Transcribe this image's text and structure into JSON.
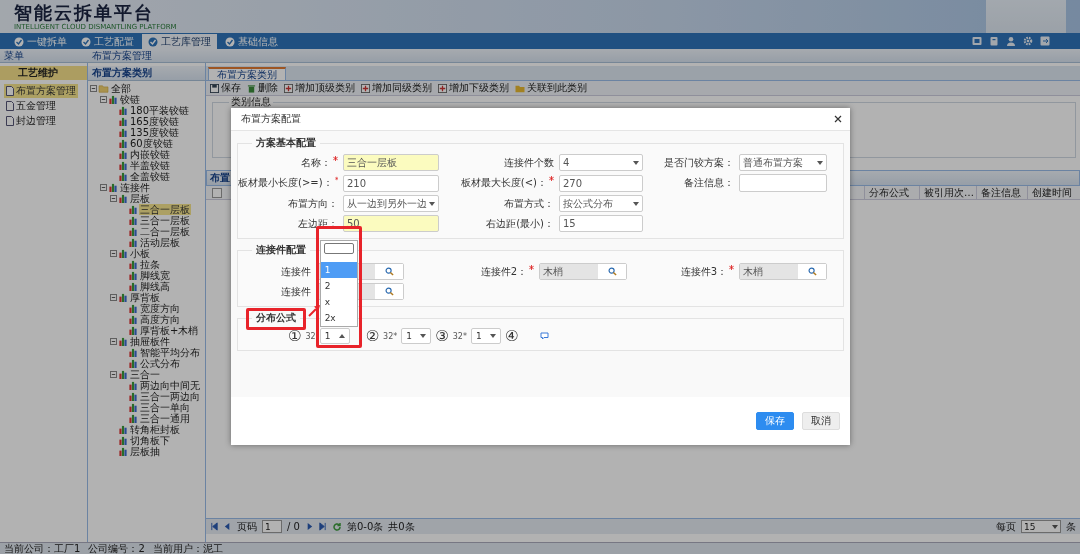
{
  "header": {
    "title": "智能云拆单平台",
    "subtitle": "INTELLIGENT CLOUD DISMANTLING PLATFORM"
  },
  "nav_tabs": [
    {
      "label": "一键拆单",
      "selected": false
    },
    {
      "label": "工艺配置",
      "selected": false
    },
    {
      "label": "工艺库管理",
      "selected": true
    },
    {
      "label": "基础信息",
      "selected": false
    }
  ],
  "menu_panel": {
    "title": "菜单",
    "section": "工艺维护",
    "items": [
      {
        "label": "布置方案管理",
        "selected": true
      },
      {
        "label": "五金管理",
        "selected": false
      },
      {
        "label": "封边管理",
        "selected": false
      }
    ]
  },
  "breadcrumb": "布置方案管理",
  "category_panel": {
    "title": "布置方案类别",
    "tree": [
      {
        "label": "全部",
        "kind": "folder",
        "expanded": true,
        "selected": false,
        "children": [
          {
            "label": "铰链",
            "kind": "category",
            "expanded": true,
            "selected": false,
            "children": [
              {
                "label": "180平装铰链",
                "kind": "category",
                "selected": false
              },
              {
                "label": "165度铰链",
                "kind": "category",
                "selected": false
              },
              {
                "label": "135度铰链",
                "kind": "category",
                "selected": false
              },
              {
                "label": "60度铰链",
                "kind": "category",
                "selected": false
              },
              {
                "label": "内嵌铰链",
                "kind": "category",
                "selected": false
              },
              {
                "label": "半盖铰链",
                "kind": "category",
                "selected": false
              },
              {
                "label": "全盖铰链",
                "kind": "category",
                "selected": false
              }
            ]
          },
          {
            "label": "连接件",
            "kind": "category",
            "expanded": true,
            "selected": false,
            "children": [
              {
                "label": "层板",
                "kind": "category",
                "expanded": true,
                "selected": false,
                "children": [
                  {
                    "label": "三合一层板",
                    "kind": "category",
                    "selected": true
                  },
                  {
                    "label": "三合一层板",
                    "kind": "category",
                    "selected": false
                  },
                  {
                    "label": "二合一层板",
                    "kind": "category",
                    "selected": false
                  },
                  {
                    "label": "活动层板",
                    "kind": "category",
                    "selected": false
                  }
                ]
              },
              {
                "label": "小板",
                "kind": "category",
                "expanded": true,
                "selected": false,
                "children": [
                  {
                    "label": "拉条",
                    "kind": "category",
                    "selected": false
                  },
                  {
                    "label": "脚线宽",
                    "kind": "category",
                    "selected": false
                  },
                  {
                    "label": "脚线高",
                    "kind": "category",
                    "selected": false
                  }
                ]
              },
              {
                "label": "厚背板",
                "kind": "category",
                "expanded": true,
                "selected": false,
                "children": [
                  {
                    "label": "宽度方向",
                    "kind": "category",
                    "selected": false
                  },
                  {
                    "label": "高度方向",
                    "kind": "category",
                    "selected": false
                  },
                  {
                    "label": "厚背板+木梢",
                    "kind": "category",
                    "selected": false
                  }
                ]
              },
              {
                "label": "抽屉板件",
                "kind": "category",
                "expanded": true,
                "selected": false,
                "children": [
                  {
                    "label": "智能平均分布",
                    "kind": "category",
                    "selected": false
                  },
                  {
                    "label": "公式分布",
                    "kind": "category",
                    "selected": false
                  }
                ]
              },
              {
                "label": "三合一",
                "kind": "category",
                "expanded": true,
                "selected": false,
                "children": [
                  {
                    "label": "两边向中间无",
                    "kind": "category",
                    "selected": false
                  },
                  {
                    "label": "三合一两边向",
                    "kind": "category",
                    "selected": false
                  },
                  {
                    "label": "三合一单向",
                    "kind": "category",
                    "selected": false
                  },
                  {
                    "label": "三合一通用",
                    "kind": "category",
                    "selected": false
                  }
                ]
              },
              {
                "label": "转角柜封板",
                "kind": "category",
                "selected": false
              },
              {
                "label": "切角板下",
                "kind": "category",
                "selected": false
              },
              {
                "label": "层板抽",
                "kind": "category",
                "selected": false
              }
            ]
          }
        ]
      }
    ]
  },
  "content_tab": {
    "label": "布置方案类别",
    "selected": true
  },
  "toolbar": [
    {
      "label": "保存",
      "kind": "save"
    },
    {
      "label": "删除",
      "kind": "delete"
    },
    {
      "label": "增加顶级类别",
      "kind": "add"
    },
    {
      "label": "增加同级类别",
      "kind": "add"
    },
    {
      "label": "增加下级类别",
      "kind": "add"
    },
    {
      "label": "关联到此类别",
      "kind": "link"
    }
  ],
  "category_info": {
    "title": "类别信息"
  },
  "grid": {
    "title": "布置",
    "select_all_checked": false,
    "columns": [
      "分布公式",
      "被引用次…",
      "备注信息",
      "创建时间"
    ]
  },
  "pager": {
    "page_label": "页码",
    "page": "1",
    "total_pages": "/ 0",
    "range": "第0-0条",
    "total": "共0条",
    "per_page_label": "每页",
    "per_page": "15",
    "unit": "条"
  },
  "status_bar": [
    "当前公司：工厂1",
    "公司编号：2",
    "当前用户：泥工"
  ],
  "dialog": {
    "title": "布置方案配置",
    "basic": {
      "legend": "方案基本配置",
      "rows": [
        [
          {
            "label": "名称：",
            "required": true,
            "kind": "text",
            "value": "三合一层板",
            "highlighted": true
          },
          {
            "label": "连接件个数",
            "required": false,
            "kind": "select",
            "value": "4"
          },
          {
            "label": "是否门铰方案：",
            "required": false,
            "kind": "select",
            "value": "普通布置方案"
          }
        ],
        [
          {
            "label": "板材最小长度(>=)：",
            "required": true,
            "kind": "text",
            "value": "210",
            "highlighted": false
          },
          {
            "label": "板材最大长度(<)：",
            "required": true,
            "kind": "text",
            "value": "270",
            "highlighted": false
          },
          {
            "label": "备注信息：",
            "required": false,
            "kind": "textarea"
          }
        ],
        [
          {
            "label": "布置方向：",
            "required": false,
            "kind": "select",
            "value": "从一边到另外一边"
          },
          {
            "label": "布置方式：",
            "required": false,
            "kind": "select",
            "value": "按公式分布"
          }
        ],
        [
          {
            "label": "左边距：",
            "required": false,
            "kind": "text",
            "value": "50",
            "highlighted": true
          },
          {
            "label": "右边距(最小)：",
            "required": false,
            "kind": "text",
            "value": "15",
            "highlighted": false
          }
        ]
      ]
    },
    "connectors": {
      "legend": "连接件配置",
      "rows": [
        [
          {
            "label": "连接件",
            "required": false,
            "kind": "lookup"
          },
          {
            "label": "连接件2：",
            "required": true,
            "kind": "lookup",
            "value": "木梢"
          },
          {
            "label": "连接件3：",
            "required": true,
            "kind": "lookup",
            "value": "木梢"
          }
        ],
        [
          {
            "label": "连接件",
            "required": false,
            "kind": "lookup"
          }
        ]
      ]
    },
    "formula": {
      "legend": "分布公式",
      "terms": [
        {
          "number": "①",
          "prefix": "32",
          "value": "1",
          "open": true
        },
        {
          "number": "②",
          "prefix": "32*",
          "value": "1",
          "open": false
        },
        {
          "number": "③",
          "prefix": "32*",
          "value": "1",
          "open": false
        }
      ],
      "last_number": "④"
    },
    "dropdown": {
      "options": [
        {
          "label": "1",
          "selected": true
        },
        {
          "label": "2",
          "selected": false
        },
        {
          "label": "x",
          "selected": false
        },
        {
          "label": "2x",
          "selected": false
        }
      ]
    },
    "buttons": [
      {
        "label": "保存",
        "kind": "primary"
      },
      {
        "label": "取消",
        "kind": "default"
      }
    ]
  }
}
